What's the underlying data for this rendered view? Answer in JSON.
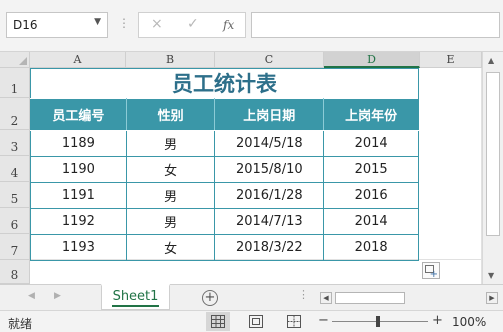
{
  "formula_bar": {
    "name_box": "D16",
    "cancel_icon": "×",
    "enter_icon": "✓",
    "function_icon": "fx",
    "formula": ""
  },
  "columns": [
    "A",
    "B",
    "C",
    "D",
    "E"
  ],
  "selected_column": "D",
  "rows": [
    "1",
    "2",
    "3",
    "4",
    "5",
    "6",
    "7",
    "8"
  ],
  "sheet": {
    "title": "员工统计表",
    "headers": [
      "员工编号",
      "性别",
      "上岗日期",
      "上岗年份"
    ],
    "records": [
      [
        "1189",
        "男",
        "2014/5/18",
        "2014"
      ],
      [
        "1190",
        "女",
        "2015/8/10",
        "2015"
      ],
      [
        "1191",
        "男",
        "2016/1/28",
        "2016"
      ],
      [
        "1192",
        "男",
        "2014/7/13",
        "2014"
      ],
      [
        "1193",
        "女",
        "2018/3/22",
        "2018"
      ]
    ],
    "header_color": "#3a97a8",
    "title_color": "#2d6f8a"
  },
  "tabs": {
    "active": "Sheet1",
    "add_icon": "+"
  },
  "status": {
    "ready": "就绪",
    "zoom_minus": "−",
    "zoom_plus": "+",
    "zoom": "100%"
  },
  "accent_color": "#217346",
  "icons": {
    "name_box_dropdown": "chevron-down-icon",
    "quick_analysis": "quick-analysis-icon",
    "views": [
      "normal-view-icon",
      "page-layout-icon",
      "page-break-preview-icon"
    ]
  }
}
